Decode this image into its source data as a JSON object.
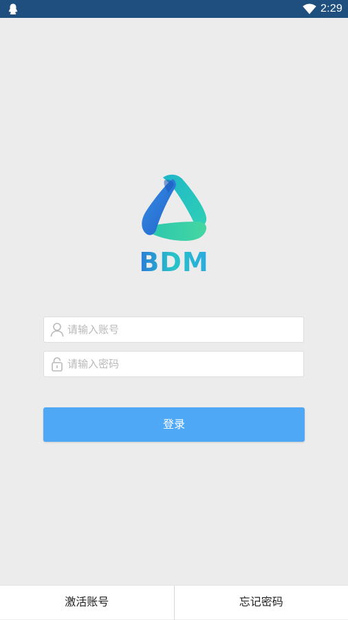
{
  "status_bar": {
    "time": "2:29",
    "left_icon": "qq-penguin-icon",
    "right_icon": "wifi-icon",
    "background": "#1f4f7e"
  },
  "logo": {
    "text": "BDM",
    "colors": {
      "blue": "#2a7bd8",
      "teal": "#2cc7c2",
      "green": "#3fd49f"
    }
  },
  "login_form": {
    "username": {
      "placeholder": "请输入账号",
      "value": "",
      "icon": "user-icon"
    },
    "password": {
      "placeholder": "请输入密码",
      "value": "",
      "icon": "lock-icon"
    },
    "submit_label": "登录",
    "submit_color": "#4fa8f5"
  },
  "bottom_bar": {
    "activate_label": "激活账号",
    "forgot_label": "忘记密码"
  }
}
